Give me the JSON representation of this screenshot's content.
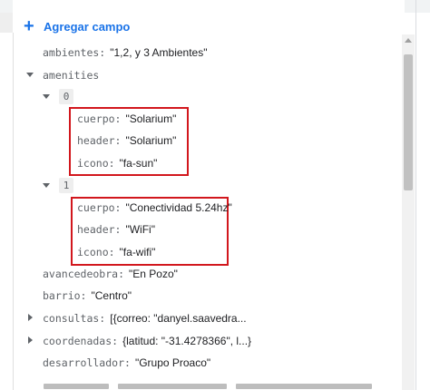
{
  "toolbar": {
    "add_field_label": "Agregar campo"
  },
  "fields": {
    "ambientes": {
      "key": "ambientes:",
      "value": "\"1,2, y 3 Ambientes\""
    },
    "amenities": {
      "key": "amenities"
    },
    "item0": {
      "index": "0",
      "cuerpo": {
        "key": "cuerpo:",
        "value": "\"Solarium\""
      },
      "header": {
        "key": "header:",
        "value": "\"Solarium\""
      },
      "icono": {
        "key": "icono:",
        "value": "\"fa-sun\""
      }
    },
    "item1": {
      "index": "1",
      "cuerpo": {
        "key": "cuerpo:",
        "value": "\"Conectividad 5.24hz\""
      },
      "header": {
        "key": "header:",
        "value": "\"WiFi\""
      },
      "icono": {
        "key": "icono:",
        "value": "\"fa-wifi\""
      }
    },
    "avancedeobra": {
      "key": "avancedeobra:",
      "value": "\"En Pozo\""
    },
    "barrio": {
      "key": "barrio:",
      "value": "\"Centro\""
    },
    "consultas": {
      "key": "consultas:",
      "value": "[{correo: \"danyel.saavedra..."
    },
    "coordenadas": {
      "key": "coordenadas:",
      "value": "{latitud: \"-31.4278366\", l...}"
    },
    "desarrollador": {
      "key": "desarrollador:",
      "value": "\"Grupo Proaco\""
    }
  },
  "colors": {
    "accent": "#1a73e8",
    "highlight_box": "#d2171d"
  },
  "icons": {
    "add": "plus-icon",
    "expanded": "caret-down-icon",
    "collapsed": "caret-right-icon"
  }
}
